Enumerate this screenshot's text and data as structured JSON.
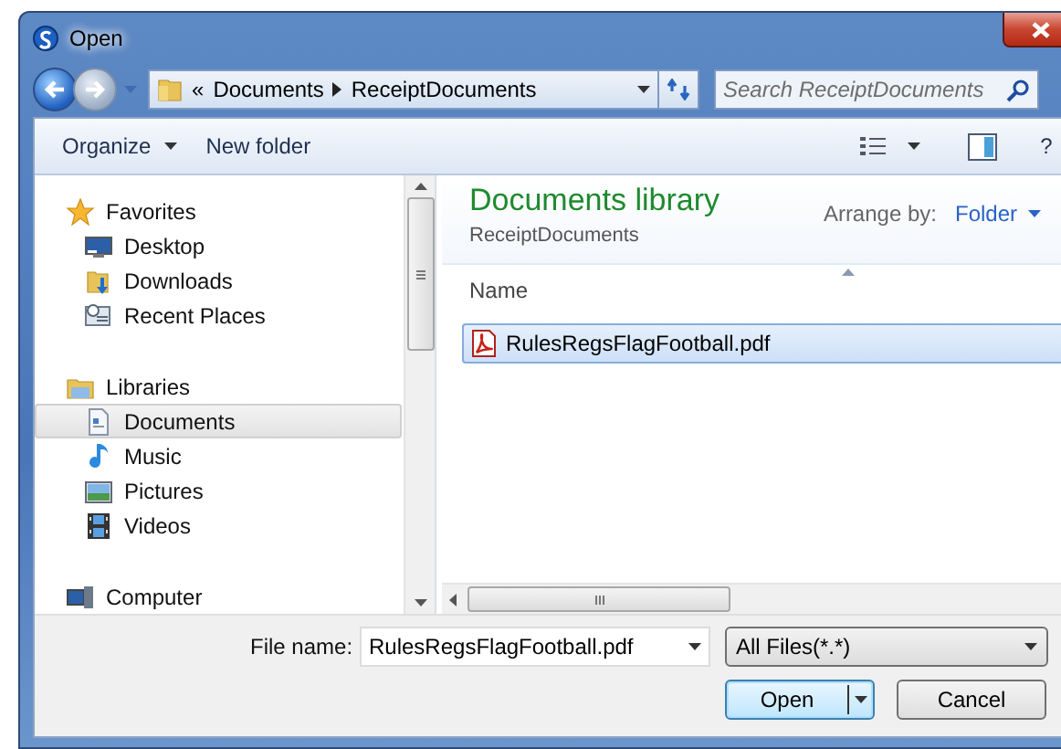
{
  "window": {
    "title": "Open"
  },
  "address_bar": {
    "overflow": "«",
    "path": [
      "Documents",
      "ReceiptDocuments"
    ]
  },
  "search": {
    "placeholder": "Search ReceiptDocuments"
  },
  "toolbar": {
    "buttons": [
      {
        "label": "Organize",
        "kind": "menu"
      },
      {
        "label": "New folder",
        "kind": "plain"
      }
    ],
    "help": "?"
  },
  "sidebar": {
    "items": [
      {
        "label": "Favorites",
        "selected": false,
        "children": [
          {
            "label": "Desktop",
            "selected": false
          },
          {
            "label": "Downloads",
            "selected": false
          },
          {
            "label": "Recent Places",
            "selected": false
          }
        ]
      },
      {
        "label": "Libraries",
        "selected": false,
        "children": [
          {
            "label": "Documents",
            "selected": true
          },
          {
            "label": "Music",
            "selected": false
          },
          {
            "label": "Pictures",
            "selected": false
          },
          {
            "label": "Videos",
            "selected": false
          }
        ]
      },
      {
        "label": "Computer",
        "selected": false
      }
    ]
  },
  "library": {
    "title": "Documents library",
    "subtitle": "ReceiptDocuments",
    "arrange_label": "Arrange by:",
    "arrange_value": "Folder"
  },
  "file_list": {
    "columns": [
      "Name"
    ],
    "files": [
      {
        "name": "RulesRegsFlagFootball.pdf",
        "selected": true
      }
    ]
  },
  "footer": {
    "file_name_label": "File name:",
    "file_name": "RulesRegsFlagFootball.pdf",
    "file_type": "All Files(*.*)",
    "buttons": [
      {
        "label": "Open",
        "kind": "split"
      },
      {
        "label": "Cancel",
        "kind": "plain"
      }
    ]
  }
}
